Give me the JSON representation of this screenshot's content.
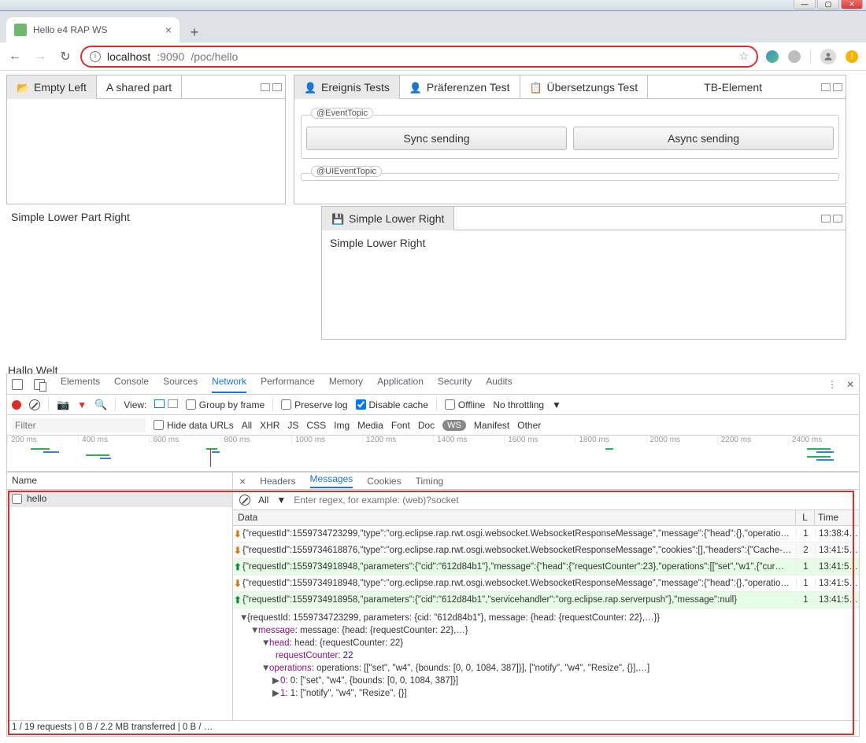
{
  "window": {
    "min": "—",
    "max": "▢",
    "close": "✕"
  },
  "browser": {
    "tab_title": "Hello e4 RAP WS",
    "url_host": "localhost",
    "url_port": ":9090",
    "url_path": "/poc/hello",
    "newtab": "+",
    "back": "←",
    "fwd": "→",
    "reload": "↻"
  },
  "rap": {
    "left_tab1": "Empty Left",
    "left_tab2": "A shared part",
    "right": {
      "tab1": "Ereignis Tests",
      "tab2": "Präferenzen Test",
      "tab3": "Übersetzungs Test",
      "tb": "TB-Element"
    },
    "fs1_legend": "@EventTopic",
    "btn_sync": "Sync sending",
    "btn_async": "Async sending",
    "fs2_legend": "@UIEventTopic",
    "lower_left": "Simple Lower Part Right",
    "lower_tab": "Simple Lower Right",
    "lower_body": "Simple Lower Right",
    "hallo": "Hallo Welt"
  },
  "devtools": {
    "tabs": [
      "Elements",
      "Console",
      "Sources",
      "Network",
      "Performance",
      "Memory",
      "Application",
      "Security",
      "Audits"
    ],
    "active_tab": "Network",
    "view_label": "View:",
    "group": "Group by frame",
    "preserve": "Preserve log",
    "disable": "Disable cache",
    "offline": "Offline",
    "throttling": "No throttling",
    "filter_placeholder": "Filter",
    "hide_urls": "Hide data URLs",
    "types": [
      "All",
      "XHR",
      "JS",
      "CSS",
      "Img",
      "Media",
      "Font",
      "Doc",
      "WS",
      "Manifest",
      "Other"
    ],
    "ticks": [
      "200 ms",
      "400 ms",
      "600 ms",
      "800 ms",
      "1000 ms",
      "1200 ms",
      "1400 ms",
      "1600 ms",
      "1800 ms",
      "2000 ms",
      "2200 ms",
      "2400 ms"
    ],
    "name_hdr": "Name",
    "name_row": "hello",
    "msg_tabs": [
      "Headers",
      "Messages",
      "Cookies",
      "Timing"
    ],
    "msg_active": "Messages",
    "msg_filter_all": "All",
    "msg_filter_ph": "Enter regex, for example: (web)?socket",
    "cols": {
      "data": "Data",
      "len": "L",
      "time": "Time"
    },
    "rows": [
      {
        "dir": "dn",
        "bg": "",
        "text": "{\"requestId\":1559734723299,\"type\":\"org.eclipse.rap.rwt.osgi.websocket.WebsocketResponseMessage\",\"message\":{\"head\":{},\"operatio…",
        "len": "1",
        "time": "13:38:4…"
      },
      {
        "dir": "dn",
        "bg": "alt",
        "text": "{\"requestId\":1559734618876,\"type\":\"org.eclipse.rap.rwt.osgi.websocket.WebsocketResponseMessage\",\"cookies\":[],\"headers\":{\"Cache-…",
        "len": "2",
        "time": "13:41:5…"
      },
      {
        "dir": "up",
        "bg": "g",
        "text": "{\"requestId\":1559734918948,\"parameters\":{\"cid\":\"612d84b1\"},\"message\":{\"head\":{\"requestCounter\":23},\"operations\":[[\"set\",\"w1\",{\"cur…",
        "len": "1",
        "time": "13:41:5…"
      },
      {
        "dir": "dn",
        "bg": "",
        "text": "{\"requestId\":1559734918948,\"type\":\"org.eclipse.rap.rwt.osgi.websocket.WebsocketResponseMessage\",\"message\":{\"head\":{},\"operatio…",
        "len": "1",
        "time": "13:41:5…"
      },
      {
        "dir": "up",
        "bg": "g",
        "text": "{\"requestId\":1559734918958,\"parameters\":{\"cid\":\"612d84b1\",\"servicehandler\":\"org.eclipse.rap.serverpush\"},\"message\":null}",
        "len": "1",
        "time": "13:41:5…"
      }
    ],
    "tree": {
      "l1": "{requestId: 1559734723299, parameters: {cid: \"612d84b1\"}, message: {head: {requestCounter: 22},…}}",
      "l2": "message: {head: {requestCounter: 22},…}",
      "l3": "head: {requestCounter: 22}",
      "l4_k": "requestCounter: ",
      "l4_v": "22",
      "l5": "operations: [[\"set\", \"w4\", {bounds: [0, 0, 1084, 387]}], [\"notify\", \"w4\", \"Resize\", {}],…]",
      "l6": "0: [\"set\", \"w4\", {bounds: [0, 0, 1084, 387]}]",
      "l7": "1: [\"notify\", \"w4\", \"Resize\", {}]"
    },
    "status": "1 / 19 requests  |  0 B / 2.2 MB transferred  |  0 B / …"
  }
}
